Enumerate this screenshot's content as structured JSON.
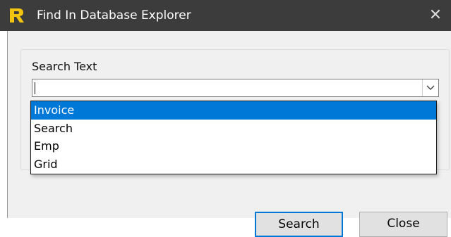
{
  "window": {
    "title": "Find In Database Explorer",
    "close_glyph": "✕",
    "app_icon": "r-app-icon",
    "close_icon": "close-icon"
  },
  "form": {
    "search_label": "Search Text",
    "search_value": "",
    "dropdown_icon": "chevron-down-icon"
  },
  "dropdown": {
    "items": [
      "Invoice",
      "Search",
      "Emp",
      "Grid"
    ],
    "selected": "Invoice"
  },
  "buttons": {
    "search_label": "Search",
    "close_label": "Close"
  },
  "colors": {
    "titlebar": "#3c3c3c",
    "accent": "#0078d7",
    "dialog_bg": "#f0f0f0"
  }
}
